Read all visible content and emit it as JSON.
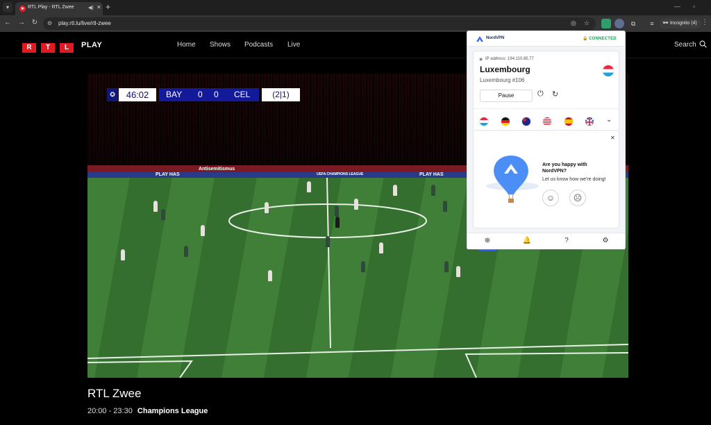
{
  "browser": {
    "tab_title": "RTL Play - RTL Zwee",
    "url": "play.rtl.lu/live/rtl-zwee",
    "incognito_label": "Incognito (4)"
  },
  "site": {
    "logo_letters": [
      "R",
      "T",
      "L"
    ],
    "logo_play": "PLAY",
    "nav": [
      "Home",
      "Shows",
      "Podcasts",
      "Live"
    ],
    "search_label": "Search"
  },
  "scoreboard": {
    "clock": "46:02",
    "home": "BAY",
    "home_score": "0",
    "away_score": "0",
    "away": "CEL",
    "aggregate": "(2|1)"
  },
  "pitch_ads": [
    "Antisemitismus",
    "PLAY HAS",
    "UEFA CHAMPIONS LEAGUE",
    "PLAY HAS"
  ],
  "program": {
    "channel": "RTL Zwee",
    "time": "20:00 - 23:30",
    "title": "Champions League"
  },
  "vpn": {
    "brand": "NordVPN",
    "status": "CONNECTED",
    "status_color": "#1a9f55",
    "ip_label": "IP address: 194.110.85.77",
    "country": "Luxembourg",
    "server": "Luxembourg #106",
    "pause_label": "Pause",
    "quick_flags": [
      "luxembourg",
      "germany",
      "australia",
      "united-states",
      "spain",
      "united-kingdom"
    ],
    "survey_question": "Are you happy with NordVPN?",
    "survey_sub": "Let us know how we're doing!",
    "footer_tabs": [
      "globe-icon",
      "bell-icon",
      "help-icon",
      "settings-icon"
    ]
  }
}
